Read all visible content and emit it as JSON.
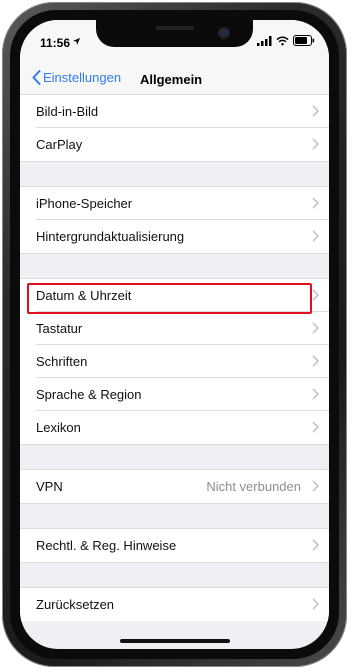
{
  "status_bar": {
    "time": "11:56",
    "location_icon": "location-arrow-icon",
    "icons": [
      "signal-bars-icon",
      "wifi-icon",
      "battery-icon"
    ]
  },
  "nav": {
    "back_label": "Einstellungen",
    "title": "Allgemein"
  },
  "groups": [
    {
      "rows": [
        {
          "name": "bild-in-bild",
          "label": "Bild-in-Bild"
        },
        {
          "name": "carplay",
          "label": "CarPlay"
        }
      ]
    },
    {
      "rows": [
        {
          "name": "iphone-speicher",
          "label": "iPhone-Speicher"
        },
        {
          "name": "hintergrundaktualisierung",
          "label": "Hintergrundaktualisierung"
        }
      ]
    },
    {
      "rows": [
        {
          "name": "datum-uhrzeit",
          "label": "Datum & Uhrzeit",
          "highlighted": true
        },
        {
          "name": "tastatur",
          "label": "Tastatur"
        },
        {
          "name": "schriften",
          "label": "Schriften"
        },
        {
          "name": "sprache-region",
          "label": "Sprache & Region"
        },
        {
          "name": "lexikon",
          "label": "Lexikon"
        }
      ]
    },
    {
      "rows": [
        {
          "name": "vpn",
          "label": "VPN",
          "value": "Nicht verbunden"
        }
      ]
    },
    {
      "rows": [
        {
          "name": "rechtl-hinweise",
          "label": "Rechtl. & Reg. Hinweise"
        }
      ]
    },
    {
      "rows": [
        {
          "name": "zuruecksetzen",
          "label": "Zurücksetzen"
        }
      ]
    }
  ],
  "colors": {
    "accent": "#2f7cf6",
    "highlight": "#e0101e",
    "background": "#efeff4",
    "chevron": "#c4c4c9"
  }
}
